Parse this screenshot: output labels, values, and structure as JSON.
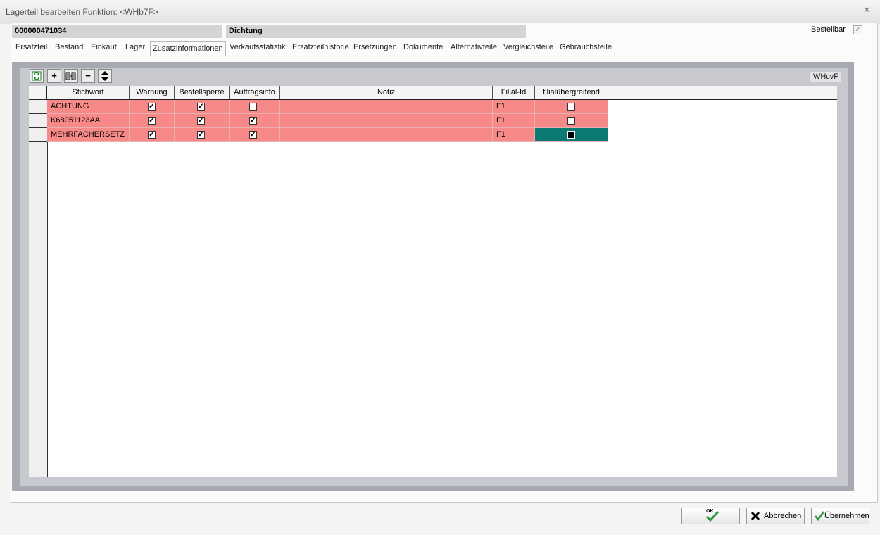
{
  "window": {
    "title": "Lagerteil bearbeiten   Funktion: <WHb7F>",
    "close_glyph": "×"
  },
  "header": {
    "part_number": "000000471034",
    "description": "Dichtung",
    "bestellbar_label": "Bestellbar",
    "bestellbar_checked": true
  },
  "tabs": [
    {
      "label": "Ersatzteil"
    },
    {
      "label": "Bestand"
    },
    {
      "label": "Einkauf"
    },
    {
      "label": "Lager"
    },
    {
      "label": "Zusatzinformationen",
      "active": true
    },
    {
      "label": "Verkaufsstatistik"
    },
    {
      "label": "Ersatzteilhistorie"
    },
    {
      "label": "Ersetzungen"
    },
    {
      "label": "Dokumente"
    },
    {
      "label": "Alternativteile"
    },
    {
      "label": "Vergleichsteile"
    },
    {
      "label": "Gebrauchsteile"
    }
  ],
  "toolbar": {
    "icons": [
      "refresh-icon",
      "plus-icon",
      "filter-icon",
      "minus-icon",
      "sort-icon"
    ],
    "code_label": "WHcvF"
  },
  "grid": {
    "columns": [
      "Stichwort",
      "Warnung",
      "Bestellsperre",
      "Auftragsinfo",
      "Notiz",
      "Filial-Id",
      "filialübergreifend"
    ],
    "rows": [
      {
        "stichwort": "ACHTUNG",
        "warnung": true,
        "bestellsperre": true,
        "auftragsinfo": false,
        "notiz": "",
        "filial_id": "F1",
        "filialuebergreifend": false
      },
      {
        "stichwort": "K68051123AA",
        "warnung": true,
        "bestellsperre": true,
        "auftragsinfo": true,
        "notiz": "",
        "filial_id": "F1",
        "filialuebergreifend": false
      },
      {
        "stichwort": "MEHRFACHERSETZ",
        "warnung": true,
        "bestellsperre": true,
        "auftragsinfo": true,
        "notiz": "",
        "filial_id": "F1",
        "filialuebergreifend": true
      }
    ],
    "row_color": "#f88989",
    "selected_cell_color": "#0a7a72"
  },
  "buttons": {
    "ok_label": "OK",
    "abbrechen_label": "Abbrechen",
    "uebernehmen_label": "Übernehmen"
  }
}
